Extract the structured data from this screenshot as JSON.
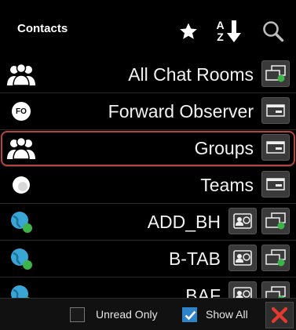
{
  "header": {
    "title": "Contacts",
    "sort_glyph_top": "A",
    "sort_glyph_bottom": "Z",
    "icons": [
      "star-icon",
      "sort-az-icon",
      "search-icon"
    ]
  },
  "contacts": [
    {
      "name": "All Chat Rooms",
      "icon": "group-icon",
      "actions": [
        "chat-room-icon"
      ]
    },
    {
      "name": "Forward Observer",
      "icon": "fo-badge-icon",
      "badge_text": "FO",
      "actions": [
        "card-icon"
      ]
    },
    {
      "name": "Groups",
      "icon": "group-icon",
      "actions": [
        "card-icon"
      ],
      "selected": true
    },
    {
      "name": "Teams",
      "icon": "team-dot-icon",
      "actions": [
        "card-icon"
      ]
    },
    {
      "name": "ADD_BH",
      "icon": "globe-online-icon",
      "actions": [
        "contact-card-icon",
        "chat-room-icon"
      ]
    },
    {
      "name": "B-TAB",
      "icon": "globe-online-icon",
      "actions": [
        "contact-card-icon",
        "chat-room-icon"
      ]
    },
    {
      "name": "BAF",
      "icon": "globe-online-icon",
      "actions": [
        "contact-card-icon",
        "chat-room-icon"
      ]
    }
  ],
  "footer": {
    "unread_only_label": "Unread Only",
    "unread_only_checked": false,
    "show_all_label": "Show All",
    "show_all_checked": true
  },
  "colors": {
    "background": "#000000",
    "selection_border": "#b8443f",
    "checkbox_checked": "#2e84c8",
    "online_green": "#3cb44a",
    "globe_blue": "#3aa6d6",
    "close_red": "#e23a2e"
  }
}
